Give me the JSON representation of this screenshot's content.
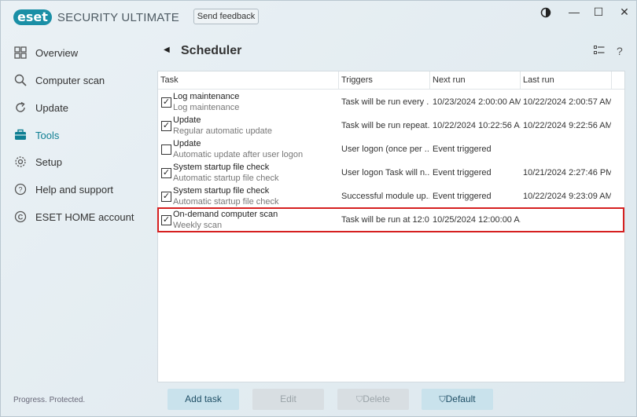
{
  "app": {
    "logo": "eset",
    "product": "SECURITY ULTIMATE",
    "feedback_label": "Send feedback",
    "status": "Progress. Protected."
  },
  "window_controls": {
    "theme_icon": "contrast-icon",
    "minimize": "—",
    "maximize": "☐",
    "close": "✕"
  },
  "sidebar": {
    "items": [
      {
        "label": "Overview",
        "icon": "overview-icon",
        "active": false
      },
      {
        "label": "Computer scan",
        "icon": "search-icon",
        "active": false
      },
      {
        "label": "Update",
        "icon": "update-icon",
        "active": false
      },
      {
        "label": "Tools",
        "icon": "briefcase-icon",
        "active": true
      },
      {
        "label": "Setup",
        "icon": "gear-icon",
        "active": false
      },
      {
        "label": "Help and support",
        "icon": "help-icon",
        "active": false
      },
      {
        "label": "ESET HOME account",
        "icon": "eset-home-icon",
        "active": false
      }
    ]
  },
  "header": {
    "title": "Scheduler",
    "back": "◀",
    "help": "?"
  },
  "table": {
    "columns": [
      "Task",
      "Triggers",
      "Next run",
      "Last run"
    ],
    "rows": [
      {
        "checked": true,
        "name": "Log maintenance",
        "sub": "Log maintenance",
        "trigger": "Task will be run every ...",
        "next": "10/23/2024 2:00:00 AM",
        "last": "10/22/2024 2:00:57 AM"
      },
      {
        "checked": true,
        "name": "Update",
        "sub": "Regular automatic update",
        "trigger": "Task will be run repeat...",
        "next": "10/22/2024 10:22:56 A...",
        "last": "10/22/2024 9:22:56 AM"
      },
      {
        "checked": false,
        "name": "Update",
        "sub": "Automatic update after user logon",
        "trigger": "User logon (once per ...",
        "next": "Event triggered",
        "last": ""
      },
      {
        "checked": true,
        "name": "System startup file check",
        "sub": "Automatic startup file check",
        "trigger": "User logon Task will n...",
        "next": "Event triggered",
        "last": "10/21/2024 2:27:46 PM"
      },
      {
        "checked": true,
        "name": "System startup file check",
        "sub": "Automatic startup file check",
        "trigger": "Successful module up...",
        "next": "Event triggered",
        "last": "10/22/2024 9:23:09 AM"
      },
      {
        "checked": true,
        "name": "On-demand computer scan",
        "sub": "Weekly scan",
        "trigger": "Task will be run at 12:0...",
        "next": "10/25/2024 12:00:00 A...",
        "last": ""
      }
    ]
  },
  "buttons": {
    "add_task": "Add task",
    "edit": "Edit",
    "delete": "Delete",
    "default": "Default"
  },
  "colors": {
    "accent": "#1a8fa6",
    "highlight_border": "#d62020"
  }
}
